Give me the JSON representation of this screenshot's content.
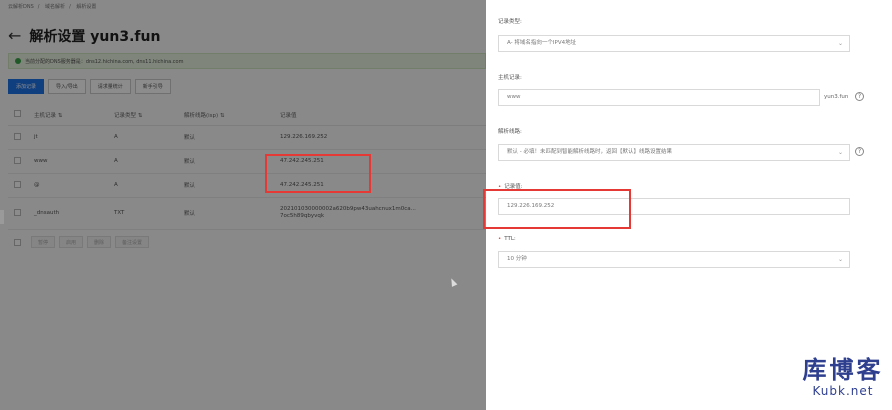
{
  "breadcrumb": [
    "云解析DNS",
    "域名解析",
    "解析设置"
  ],
  "page": {
    "title": "解析设置 yun3.fun",
    "dns_notice": "当前分配的DNS服务器是：dns12.hichina.com, dns11.hichina.com"
  },
  "toolbar": {
    "add_record": "添加记录",
    "import_export": "导入/导出",
    "request_stats": "请求量统计",
    "guide": "新手引导"
  },
  "table": {
    "headers": [
      "主机记录 ⇅",
      "记录类型 ⇅",
      "解析线路(isp) ⇅",
      "记录值"
    ],
    "rows": [
      {
        "host": "jt",
        "type": "A",
        "line": "默认",
        "value": "129.226.169.252",
        "value2": ""
      },
      {
        "host": "www",
        "type": "A",
        "line": "默认",
        "value": "47.242.245.251",
        "value2": ""
      },
      {
        "host": "@",
        "type": "A",
        "line": "默认",
        "value": "47.242.245.251",
        "value2": ""
      },
      {
        "host": "_dnsauth",
        "type": "TXT",
        "line": "默认",
        "value": "202101030000002a620b9pw43uahcnux1m0ca...",
        "value2": "7oc5h89qbyvqk"
      }
    ]
  },
  "bulk_actions": [
    "暂停",
    "启用",
    "删除",
    "备注设置"
  ],
  "drawer": {
    "record_type_label": "记录类型:",
    "record_type_value": "A- 将域名指向一个IPV4地址",
    "host_label": "主机记录:",
    "host_value": "www",
    "host_suffix": "yun3.fun",
    "line_label": "解析线路:",
    "line_value": "默认 - 必填！未匹配到智能解析线路时，返回【默认】线路设置结果",
    "value_label": "记录值:",
    "value_value": "129.226.169.252",
    "ttl_label": "TTL:",
    "ttl_value": "10 分钟",
    "help_glyph": "?"
  },
  "watermark": {
    "line1": "库博客",
    "line2": "Kubk.net"
  }
}
